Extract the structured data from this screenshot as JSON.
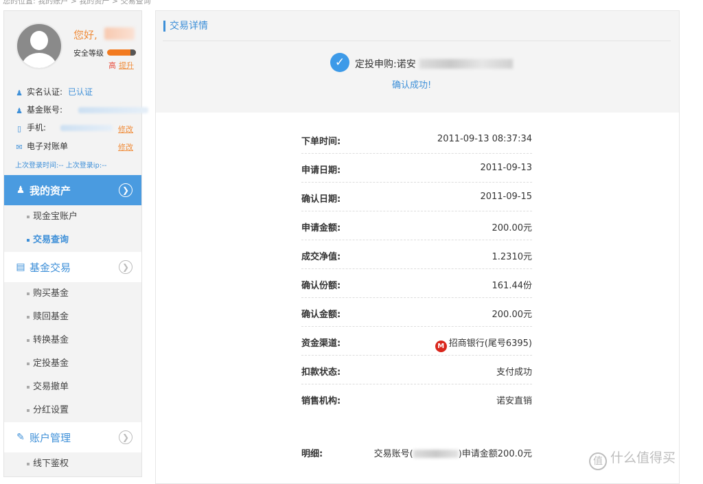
{
  "breadcrumb": "您的位置: 我的账户 > 我的资产 > 交易查询",
  "profile": {
    "greeting": "您好,",
    "security_label": "安全等级",
    "security_level": "高",
    "upgrade": "提升",
    "realname_label": "实名认证:",
    "realname_value": "已认证",
    "fund_account_label": "基金账号:",
    "phone_label": "手机:",
    "phone_edit": "修改",
    "ebill_label": "电子对账单",
    "ebill_edit": "修改",
    "last_login": "上次登录时间:--  上次登录ip:--"
  },
  "menu": {
    "assets": {
      "label": "我的资产",
      "items": [
        "现金宝账户",
        "交易查询"
      ]
    },
    "fund_trade": {
      "label": "基金交易",
      "items": [
        "购买基金",
        "赎回基金",
        "转换基金",
        "定投基金",
        "交易撤单",
        "分红设置"
      ]
    },
    "account": {
      "label": "账户管理",
      "items": [
        "线下鉴权"
      ]
    }
  },
  "main": {
    "title": "交易详情",
    "deal_title": "定投申购:诺安",
    "confirm_text": "确认成功!",
    "rows": [
      {
        "key": "下单时间:",
        "value": "2011-09-13 08:37:34"
      },
      {
        "key": "申请日期:",
        "value": "2011-09-13"
      },
      {
        "key": "确认日期:",
        "value": "2011-09-15"
      },
      {
        "key": "申请金额:",
        "value": "200.00元"
      },
      {
        "key": "成交净值:",
        "value": "1.2310元"
      },
      {
        "key": "确认份额:",
        "value": "161.44份"
      },
      {
        "key": "确认金额:",
        "value": "200.00元"
      },
      {
        "key": "资金渠道:",
        "value": "招商银行(尾号6395)"
      },
      {
        "key": "扣款状态:",
        "value": "支付成功"
      },
      {
        "key": "销售机构:",
        "value": "诺安直销"
      }
    ],
    "detail_key": "明细:",
    "detail_prefix": "交易账号(",
    "detail_suffix": ")申请金额200.0元"
  },
  "watermark": "什么值得买",
  "icons": [
    "user-icon",
    "id-icon",
    "phone-icon",
    "mail-icon",
    "chevron-right-icon",
    "check-icon",
    "bank-logo-icon",
    "chart-icon",
    "book-icon"
  ]
}
